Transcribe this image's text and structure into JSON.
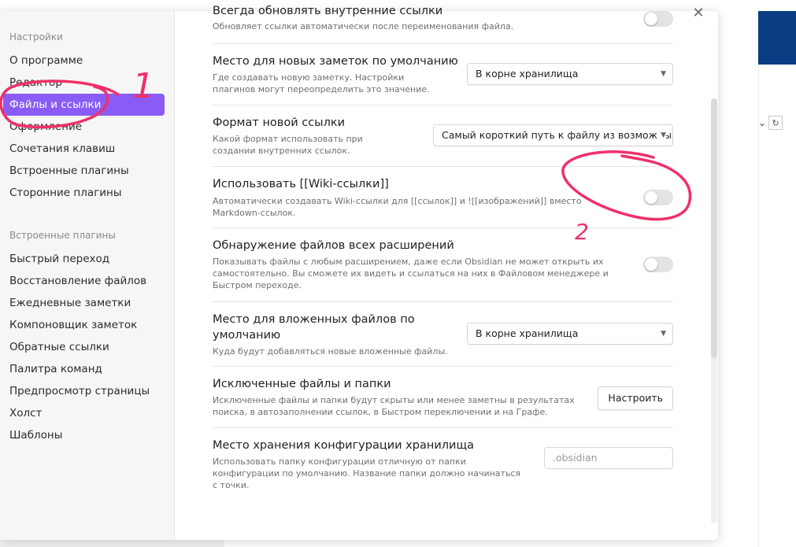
{
  "sidebar": {
    "settings_heading": "Настройки",
    "settings_items": [
      {
        "label": "О программе"
      },
      {
        "label": "Редактор"
      },
      {
        "label": "Файлы и ссылки",
        "active": true
      },
      {
        "label": "Оформление"
      },
      {
        "label": "Сочетания клавиш"
      },
      {
        "label": "Встроенные плагины"
      },
      {
        "label": "Сторонние плагины"
      }
    ],
    "plugins_heading": "Встроенные плагины",
    "plugin_items": [
      {
        "label": "Быстрый переход"
      },
      {
        "label": "Восстановление файлов"
      },
      {
        "label": "Ежедневные заметки"
      },
      {
        "label": "Компоновщик заметок"
      },
      {
        "label": "Обратные ссылки"
      },
      {
        "label": "Палитра команд"
      },
      {
        "label": "Предпросмотр страницы"
      },
      {
        "label": "Холст"
      },
      {
        "label": "Шаблоны"
      }
    ]
  },
  "modal": {
    "close_icon": "close-icon"
  },
  "settings": [
    {
      "title": "Всегда обновлять внутренние ссылки",
      "desc": "Обновляет ссылки автоматически после переименования файла.",
      "control": "toggle",
      "value": false
    },
    {
      "title": "Место для новых заметок по умолчанию",
      "desc": "Где создавать новую заметку. Настройки плагинов могут переопределить это значение.",
      "control": "dropdown",
      "value": "В корне хранилища"
    },
    {
      "title": "Формат новой ссылки",
      "desc": "Какой формат использовать при создании внутренних ссылок.",
      "control": "dropdown",
      "value": "Самый короткий путь к файлу из возможных"
    },
    {
      "title": "Использовать [[Wiki-ссылки]]",
      "desc": "Автоматически создавать Wiki-ссылки для [[ссылок]] и ![[изображений]] вместо Markdown-ссылок.",
      "control": "toggle",
      "value": false
    },
    {
      "title": "Обнаружение файлов всех расширений",
      "desc": "Показывать файлы с любым расширением, даже если Obsidian не может открыть их самостоятельно. Вы сможете их видеть и ссылаться на них в Файловом менеджере и Быстром переходе.",
      "control": "toggle",
      "value": false
    },
    {
      "title": "Место для вложенных файлов по умолчанию",
      "desc": "Куда будут добавляться новые вложенные файлы.",
      "control": "dropdown",
      "value": "В корне хранилища"
    },
    {
      "title": "Исключенные файлы и папки",
      "desc": "Исключенные файлы и папки будут скрыты или менее заметны в результатах поиска, в автозаполнении ссылок, в Быстром переключении и на Графе.",
      "control": "button",
      "value": "Настроить"
    },
    {
      "title": "Место хранения конфигурации хранилища",
      "desc": "Использовать папку конфигурации отличную от папки конфигурации по умолчанию. Название папки должно начинаться с точки.",
      "control": "input",
      "placeholder": ".obsidian"
    }
  ],
  "annotations": {
    "mark1": "1",
    "mark2": "2",
    "color": "#f0306a"
  },
  "colors": {
    "accent": "#8a5cf5",
    "background_app_header": "#0b3d82"
  }
}
